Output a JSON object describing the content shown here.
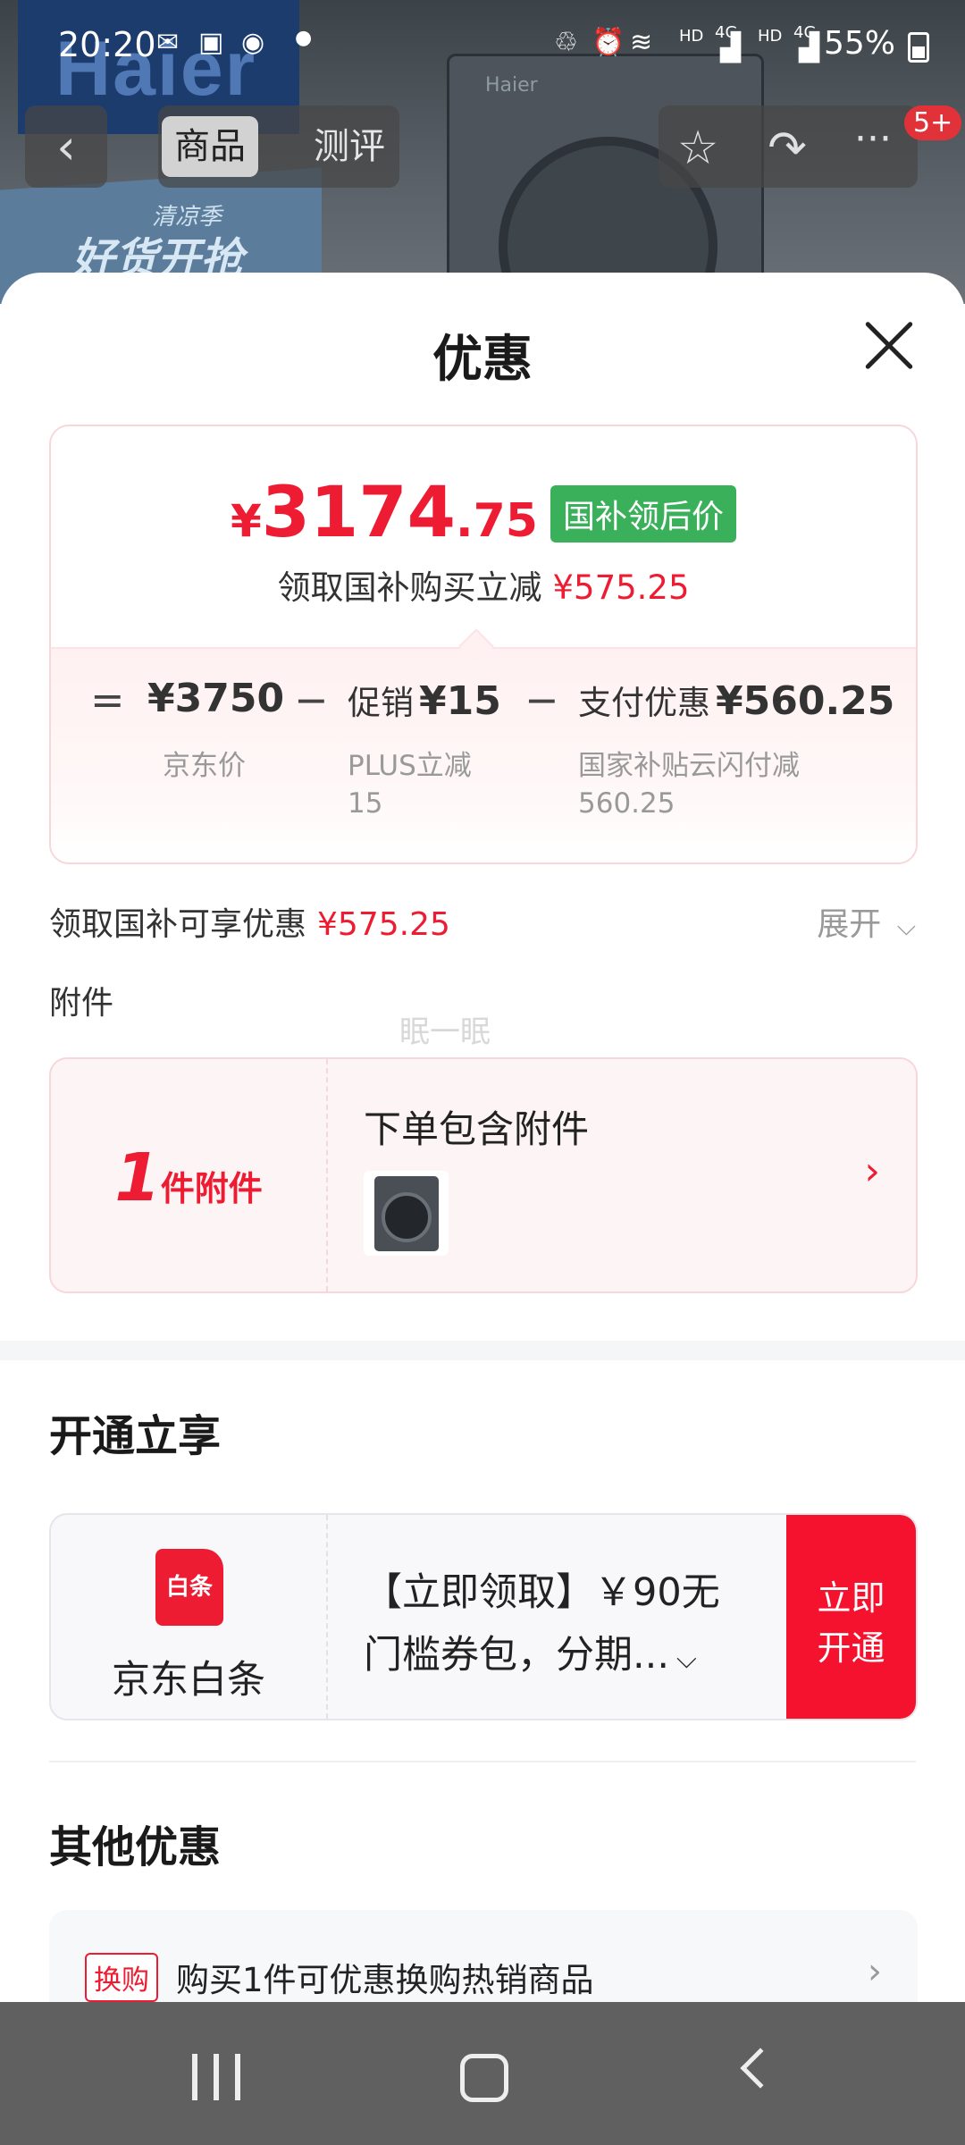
{
  "status_bar": {
    "time": "20:20",
    "battery": "55%",
    "signal_1": "4G",
    "signal_2": "4G",
    "hd": "HD"
  },
  "background_page": {
    "brand": "Haier",
    "washer_brand": "Haier",
    "promo_text": "好货开抢",
    "promo_sub": "清凉季",
    "tabs": [
      {
        "label": "商品",
        "active": true
      },
      {
        "label": "测评",
        "active": false
      }
    ],
    "badge": "5+"
  },
  "sheet": {
    "title": "优惠"
  },
  "price_card": {
    "currency": "¥",
    "price_int": "3174",
    "price_dec": ".75",
    "tag": "国补领后价",
    "sub_text": "领取国补购买立减",
    "sub_amount": "¥575.25",
    "calc": {
      "eq": "=",
      "minus": "−",
      "item1_value": "¥3750",
      "item1_label": "京东价",
      "item2_name": "促销",
      "item2_value": "¥15",
      "item2_label_1": "PLUS立减",
      "item2_label_2": "15",
      "item3_name": "支付优惠",
      "item3_value": "¥560.25",
      "item3_label_1": "国家补贴云闪付减",
      "item3_label_2": "560.25"
    }
  },
  "discount_row": {
    "label": "领取国补可享优惠",
    "amount": "¥575.25",
    "expand": "展开"
  },
  "attachments": {
    "title": "附件",
    "watermark": "眠一眠",
    "count": "1",
    "unit": "件附件",
    "text": "下单包含附件"
  },
  "activate_section": {
    "title": "开通立享",
    "logo_text": "白条",
    "name": "京东白条",
    "desc_line1": "【立即领取】￥90无",
    "desc_line2": "门槛券包，分期...",
    "button_line1": "立即",
    "button_line2": "开通"
  },
  "other_section": {
    "title": "其他优惠",
    "swap_tag": "换购",
    "swap_text": "购买1件可优惠换购热销商品"
  },
  "colors": {
    "accent_red": "#ee1c32",
    "tag_green": "#3ab05a",
    "button_red": "#f4122f"
  }
}
